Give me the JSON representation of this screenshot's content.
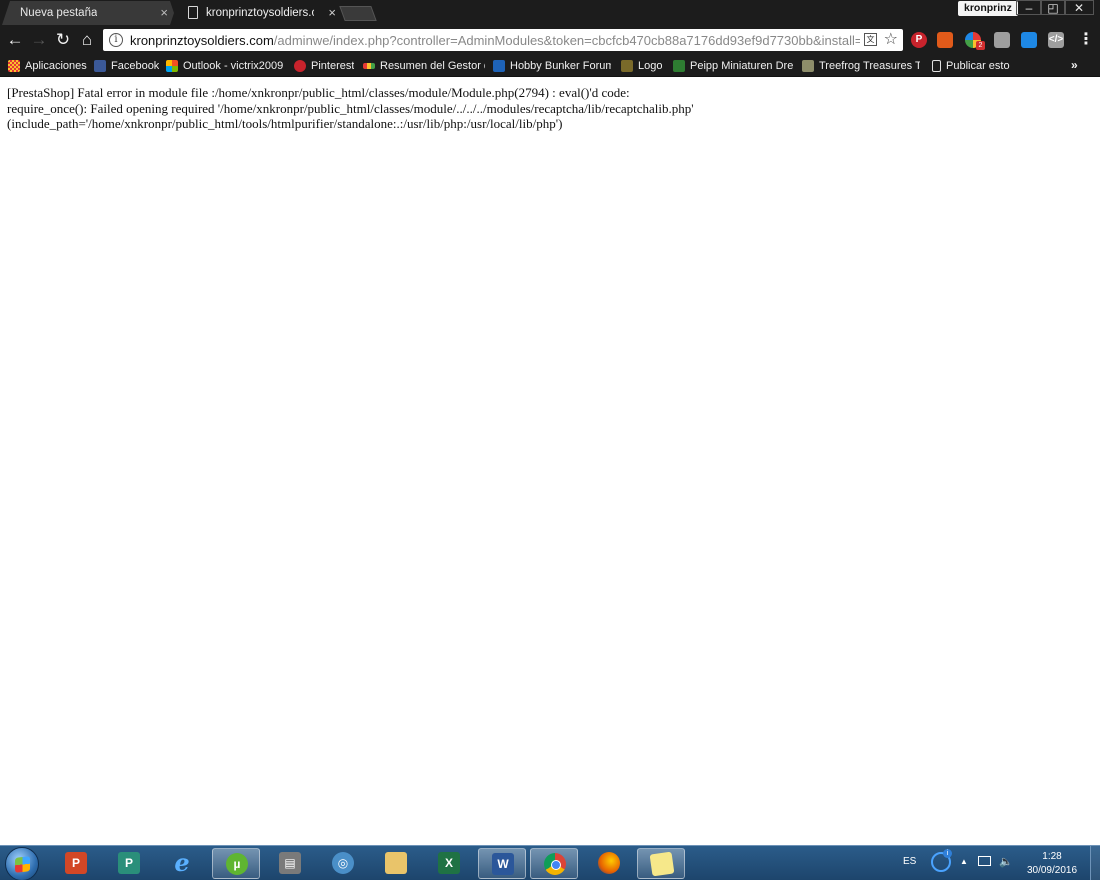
{
  "browser": {
    "tabs": [
      {
        "title": "Nueva pestaña",
        "close": "×"
      },
      {
        "title": "kronprinztoysoldiers.com",
        "close": "×"
      }
    ],
    "profile_name": "kronprinz",
    "window_controls": {
      "minimize": "–",
      "maximize": "◰",
      "close": "✕"
    },
    "nav": {
      "back": "←",
      "forward": "→",
      "reload": "↻",
      "home": "⌂",
      "menu": "⋮"
    },
    "omnibox": {
      "info": "i",
      "url_host": "kronprinztoysoldiers.com",
      "url_path": "/adminwe/index.php?controller=AdminModules&token=cbcfcb470cb88a7176dd93ef9d7730bb&install=recaptcha",
      "star": "☆"
    },
    "extensions": [
      {
        "name": "pinterest-extension",
        "glyph": "P",
        "color": "#c8232c"
      },
      {
        "name": "chart-extension",
        "glyph": "",
        "color": "#e05a1a"
      },
      {
        "name": "colors-extension",
        "glyph": "",
        "badge": "2"
      },
      {
        "name": "puzzle-extension",
        "glyph": "",
        "color": "#9e9e9e"
      },
      {
        "name": "cast-extension",
        "glyph": "",
        "color": "#1e88e5"
      },
      {
        "name": "code-extension",
        "glyph": "</>",
        "color": "#9e9e9e"
      }
    ],
    "bookmarks": [
      {
        "label": "Aplicaciones"
      },
      {
        "label": "Facebook"
      },
      {
        "label": "Outlook - victrix2009"
      },
      {
        "label": "Pinterest"
      },
      {
        "label": "Resumen del Gestor de"
      },
      {
        "label": "Hobby Bunker Forums"
      },
      {
        "label": "Logo"
      },
      {
        "label": "Peipp Miniaturen Dres"
      },
      {
        "label": "Treefrog Treasures To"
      },
      {
        "label": "Publicar esto"
      }
    ],
    "bookmarks_more": "»"
  },
  "page": {
    "error_lines": [
      "[PrestaShop] Fatal error in module file :/home/xnkronpr/public_html/classes/module/Module.php(2794) : eval()'d code:",
      "require_once(): Failed opening required '/home/xnkronpr/public_html/classes/module/../../../modules/recaptcha/lib/recaptchalib.php'",
      "(include_path='/home/xnkronpr/public_html/tools/htmlpurifier/standalone:.:/usr/lib/php:/usr/local/lib/php')"
    ]
  },
  "taskbar": {
    "apps": [
      {
        "name": "PowerPoint",
        "glyph": "P"
      },
      {
        "name": "Publisher",
        "glyph": "P"
      },
      {
        "name": "Internet Explorer",
        "glyph": "e"
      },
      {
        "name": "uTorrent",
        "glyph": "µ"
      },
      {
        "name": "Print",
        "glyph": "▤"
      },
      {
        "name": "Network",
        "glyph": "◎"
      },
      {
        "name": "File Explorer",
        "glyph": ""
      },
      {
        "name": "Excel",
        "glyph": "X"
      },
      {
        "name": "Word",
        "glyph": "W"
      },
      {
        "name": "Chrome",
        "glyph": ""
      },
      {
        "name": "Firefox",
        "glyph": ""
      },
      {
        "name": "Sticky Notes",
        "glyph": ""
      }
    ],
    "language": "ES",
    "tray_badge": "i",
    "tray_chevron": "▲",
    "volume": "🔈",
    "time": "1:28",
    "date": "30/09/2016"
  }
}
